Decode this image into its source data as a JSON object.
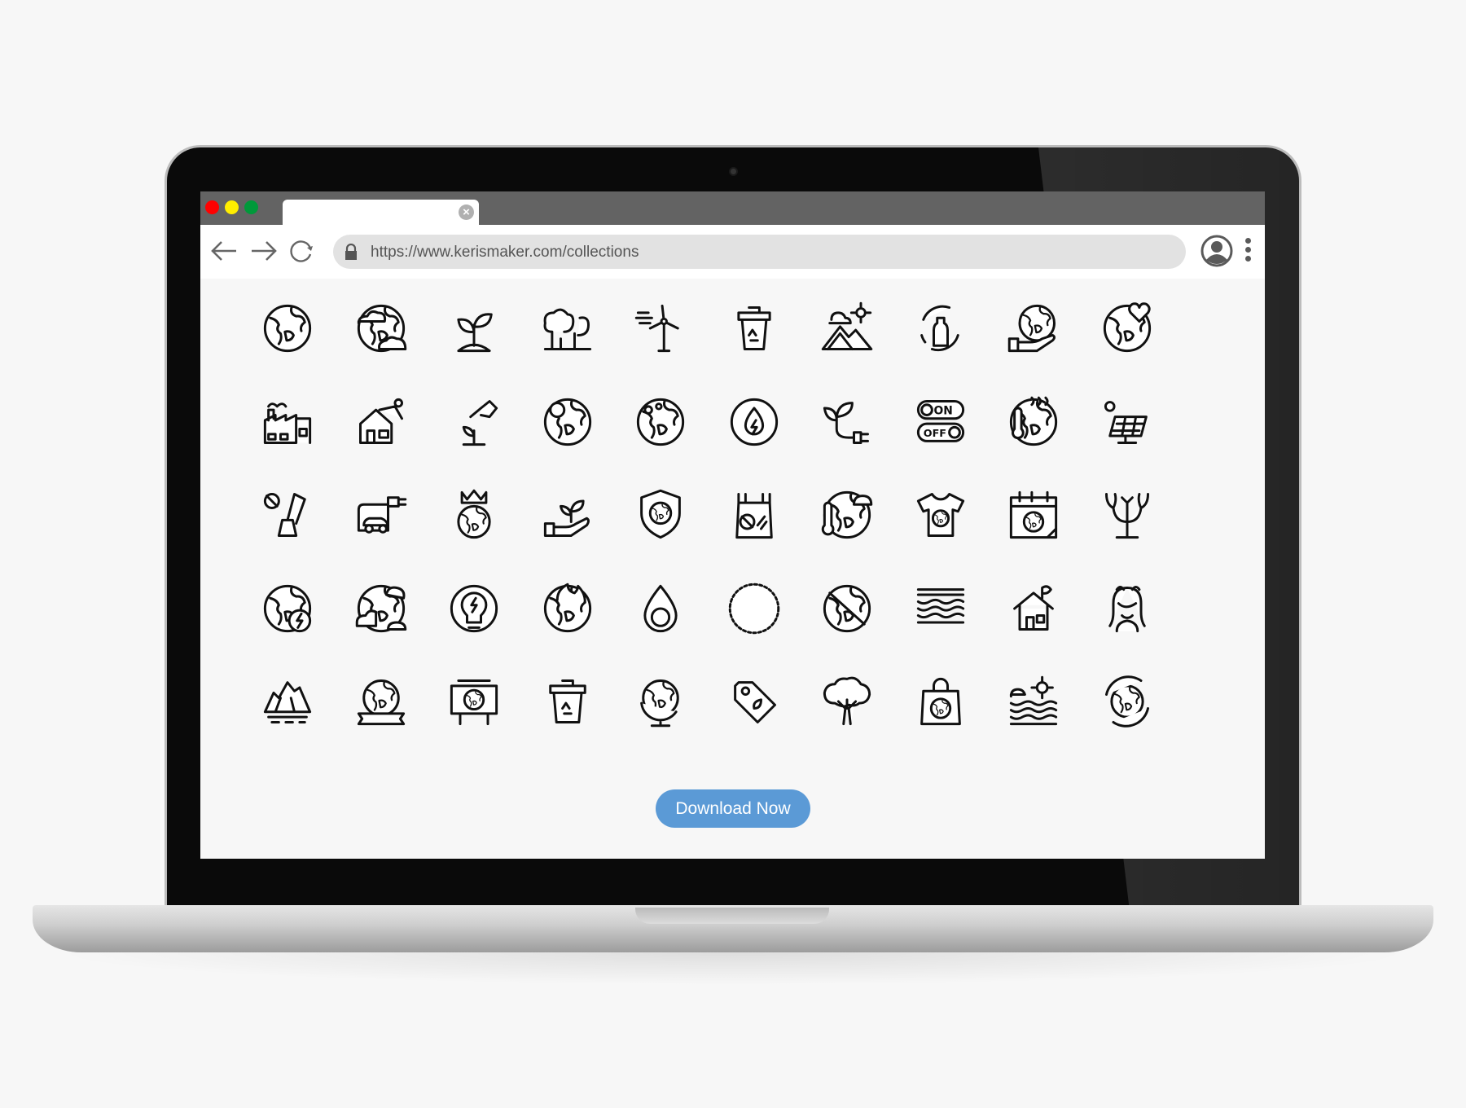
{
  "browser": {
    "traffic_lights": [
      "#ff0000",
      "#ffee00",
      "#00993a"
    ],
    "tab": {
      "title": "",
      "close_icon": "close-circle-icon"
    },
    "url": "https://www.kerismaker.com/collections",
    "nav_icons": [
      "back-arrow-icon",
      "forward-arrow-icon",
      "reload-icon"
    ]
  },
  "icons": [
    [
      "earth",
      "earth-clouds",
      "sprout",
      "forest",
      "wind-turbine",
      "recycle-bin",
      "mountains-sun",
      "bottle-recycle",
      "earth-hand",
      "earth-heart"
    ],
    [
      "factory",
      "solar-house",
      "watering-can",
      "earth-sun",
      "earth-pollution",
      "water-energy",
      "plant-plug",
      "on-off-switch",
      "earth-warming",
      "solar-panel"
    ],
    [
      "no-deforestation",
      "electric-car",
      "earth-crown",
      "plant-hand",
      "earth-shield",
      "no-plastic-bag",
      "earth-temperature",
      "earth-tshirt",
      "earth-day-calendar",
      "coral"
    ],
    [
      "earth-energy",
      "earth-smog",
      "eco-bulb",
      "earth-fire",
      "water-drop-earth",
      "earth-stamp",
      "earth-no-pollution",
      "water-pollution",
      "eco-house",
      "mother-nature"
    ],
    [
      "iceberg",
      "earth-banner",
      "earth-billboard",
      "recycle-trash",
      "globe",
      "eco-tag",
      "tree",
      "eco-bag",
      "sea-sun",
      "earth-cycle"
    ]
  ],
  "switch_labels": {
    "on": "ON",
    "off": "OFF"
  },
  "cta": {
    "label": "Download Now",
    "color": "#5b9ad6"
  }
}
